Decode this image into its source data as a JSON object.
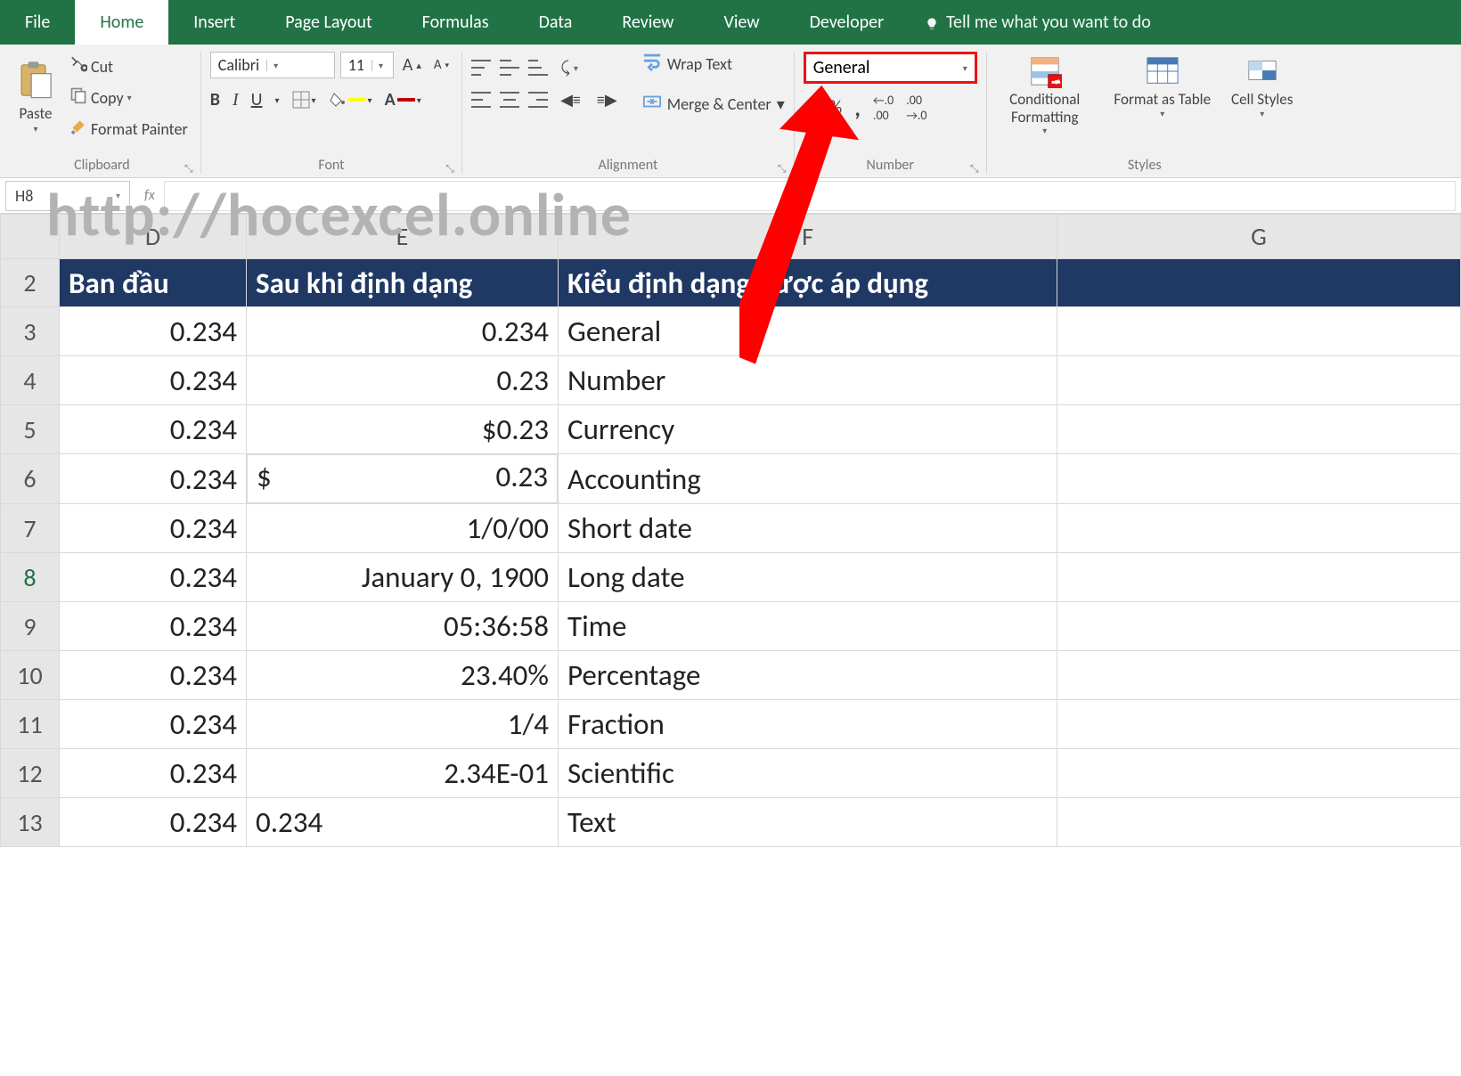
{
  "tabs": [
    "File",
    "Home",
    "Insert",
    "Page Layout",
    "Formulas",
    "Data",
    "Review",
    "View",
    "Developer"
  ],
  "active_tab": "Home",
  "tellme": "Tell me what you want to do",
  "ribbon": {
    "clipboard": {
      "label": "Clipboard",
      "paste": "Paste",
      "cut": "Cut",
      "copy": "Copy",
      "fp": "Format Painter"
    },
    "font": {
      "label": "Font",
      "name": "Calibri",
      "size": "11"
    },
    "alignment": {
      "label": "Alignment",
      "wrap": "Wrap Text",
      "merge": "Merge & Center"
    },
    "number": {
      "label": "Number",
      "format": "General"
    },
    "styles": {
      "label": "Styles",
      "cond": "Conditional Formatting",
      "fat": "Format as Table",
      "cell": "Cell Styles"
    }
  },
  "namebox": "H8",
  "watermark": "http://hocexcel.online",
  "columns": [
    "D",
    "E",
    "F",
    "G"
  ],
  "header_row_num": "2",
  "headers": {
    "D": "Ban đầu",
    "E": "Sau khi định dạng",
    "F": "Kiểu định dạng được áp dụng"
  },
  "rows": [
    {
      "n": "3",
      "d": "0.234",
      "e": "0.234",
      "f": "General"
    },
    {
      "n": "4",
      "d": "0.234",
      "e": "0.23",
      "f": "Number"
    },
    {
      "n": "5",
      "d": "0.234",
      "e": "$0.23",
      "f": "Currency"
    },
    {
      "n": "6",
      "d": "0.234",
      "e_acc_sym": "$",
      "e_acc_val": "0.23",
      "f": "Accounting"
    },
    {
      "n": "7",
      "d": "0.234",
      "e": "1/0/00",
      "f": "Short date"
    },
    {
      "n": "8",
      "d": "0.234",
      "e": "January 0, 1900",
      "f": "Long date",
      "active": true
    },
    {
      "n": "9",
      "d": "0.234",
      "e": "05:36:58",
      "f": "Time"
    },
    {
      "n": "10",
      "d": "0.234",
      "e": "23.40%",
      "f": "Percentage"
    },
    {
      "n": "11",
      "d": "0.234",
      "e": "1/4",
      "f": "Fraction"
    },
    {
      "n": "12",
      "d": "0.234",
      "e": "2.34E-01",
      "f": "Scientific"
    },
    {
      "n": "13",
      "d": "0.234",
      "e": "0.234",
      "e_align": "l",
      "f": "Text"
    }
  ]
}
